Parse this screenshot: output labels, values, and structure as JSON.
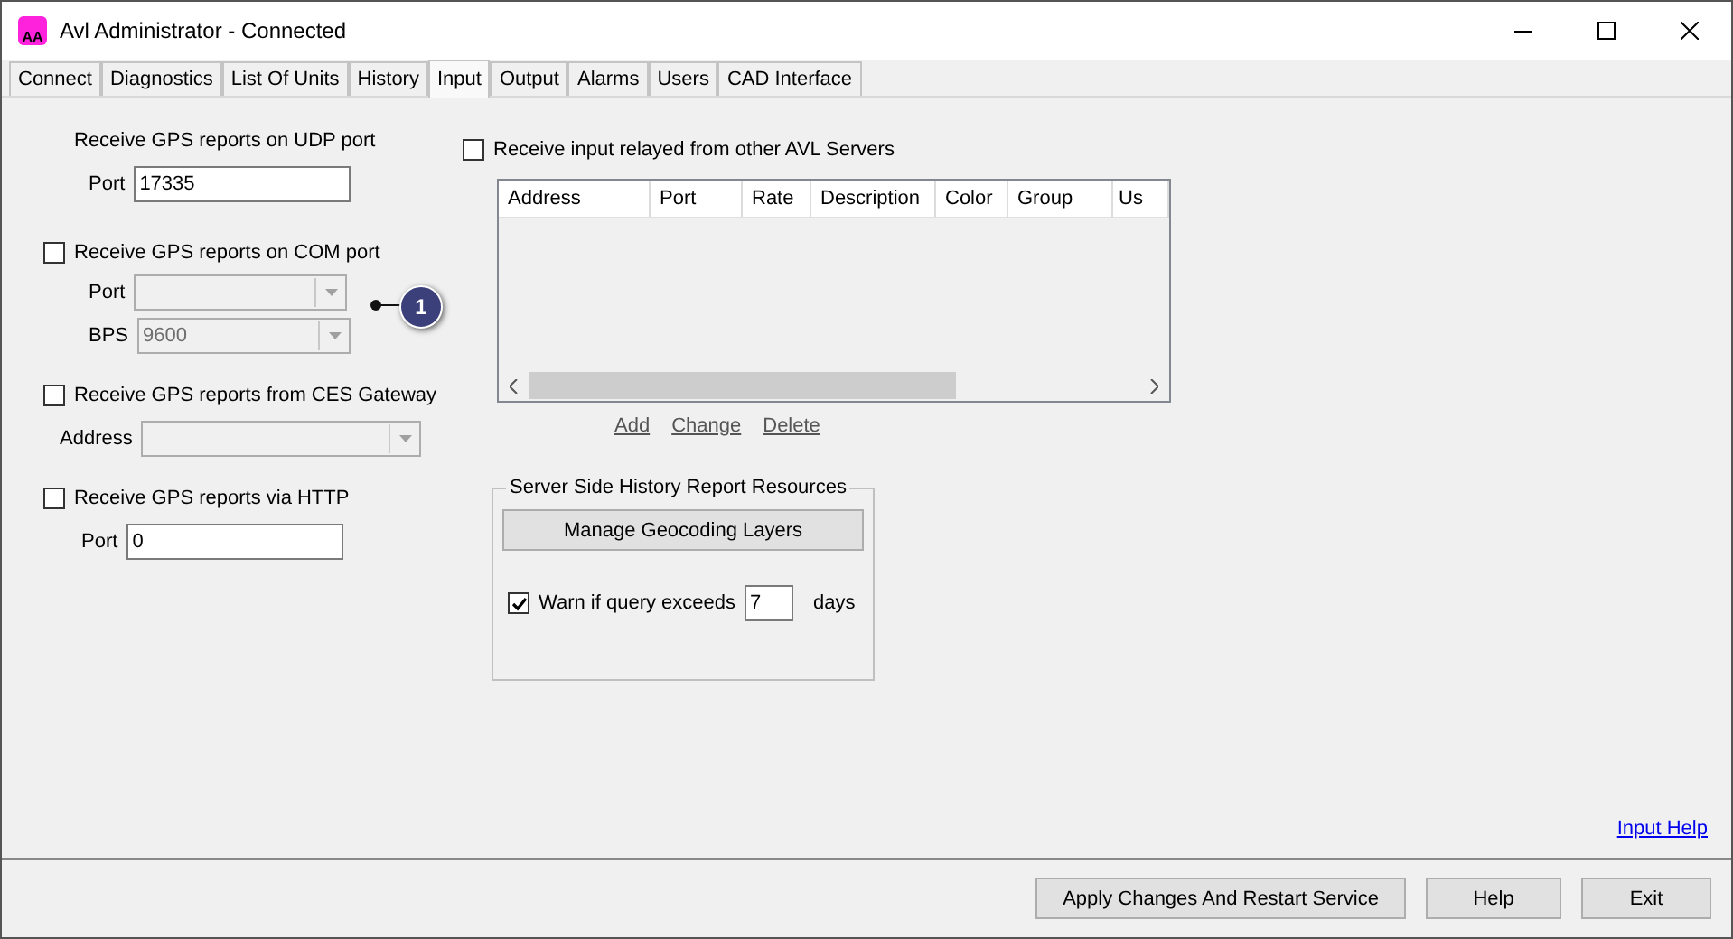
{
  "window": {
    "title": "Avl Administrator - Connected",
    "app_icon_letters": "AA"
  },
  "tabs": [
    {
      "label": "Connect",
      "selected": false
    },
    {
      "label": "Diagnostics",
      "selected": false
    },
    {
      "label": "List Of Units",
      "selected": false
    },
    {
      "label": "History",
      "selected": false
    },
    {
      "label": "Input",
      "selected": true
    },
    {
      "label": "Output",
      "selected": false
    },
    {
      "label": "Alarms",
      "selected": false
    },
    {
      "label": "Users",
      "selected": false
    },
    {
      "label": "CAD Interface",
      "selected": false
    }
  ],
  "udp": {
    "title": "Receive GPS reports on UDP port",
    "port_label": "Port",
    "port_value": "17335"
  },
  "com": {
    "label": "Receive GPS reports on COM port",
    "checked": false,
    "port_label": "Port",
    "bps_label": "BPS",
    "bps_value": "9600",
    "disabled": true,
    "callout": "1"
  },
  "ces": {
    "label": "Receive GPS reports from CES Gateway",
    "checked": false,
    "address_label": "Address",
    "disabled": true
  },
  "http": {
    "label": "Receive GPS reports via HTTP",
    "checked": false,
    "port_label": "Port",
    "port_value": "0"
  },
  "relay": {
    "label": "Receive input relayed from other AVL Servers",
    "checked": false,
    "columns": [
      "Address",
      "Port",
      "Rate",
      "Description",
      "Color",
      "Group",
      "Us"
    ],
    "links": [
      "Add",
      "Change",
      "Delete"
    ]
  },
  "history_group": {
    "title": "Server Side History Report Resources",
    "button": "Manage Geocoding Layers",
    "warn_label": "Warn if query exceeds",
    "warn_checked": true,
    "days_value": "7",
    "days_unit": "days"
  },
  "help_link": "Input Help",
  "buttons": [
    "Apply Changes And Restart Service",
    "Help",
    "Exit"
  ]
}
